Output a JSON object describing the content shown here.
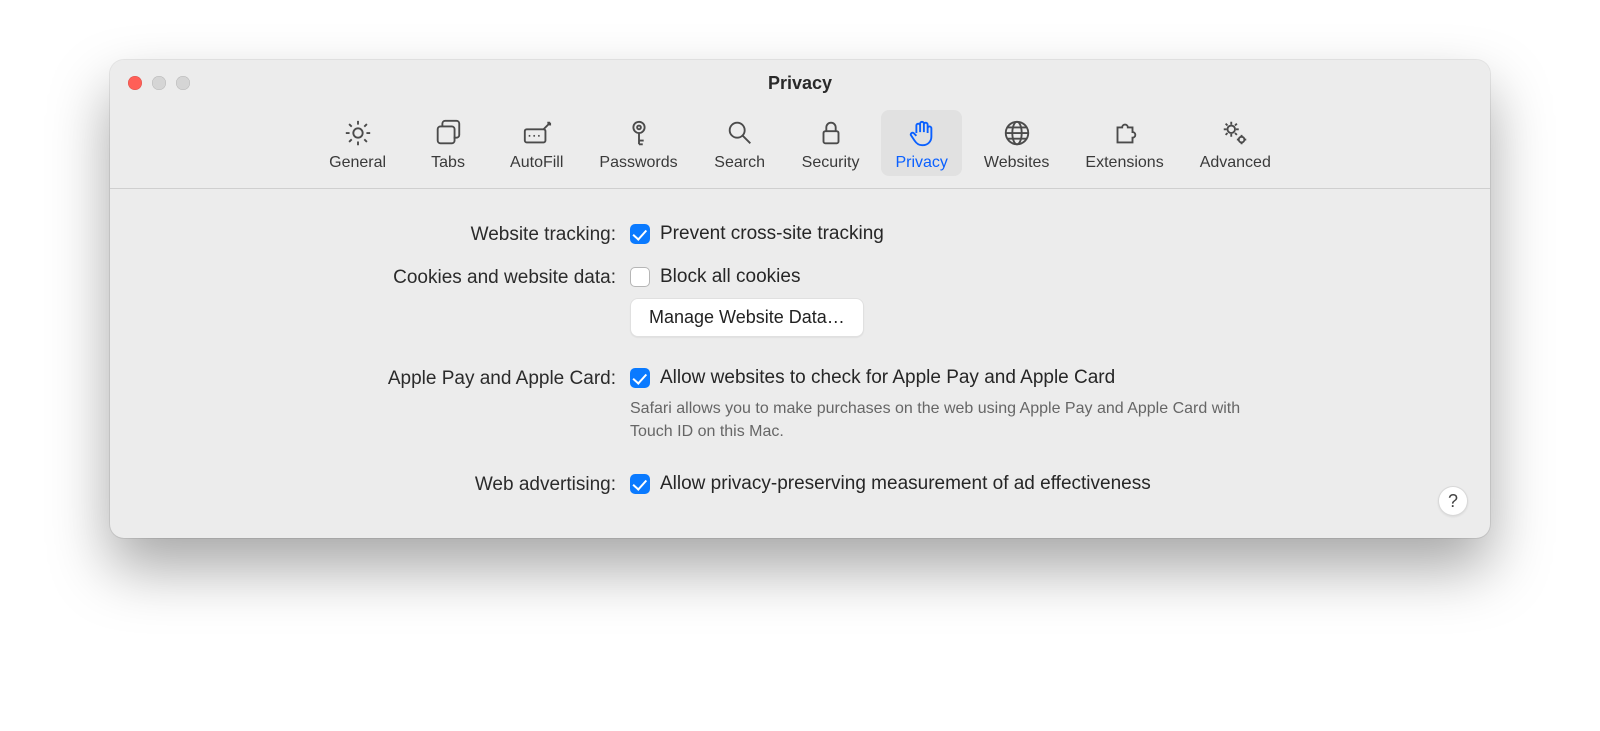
{
  "window": {
    "title": "Privacy"
  },
  "toolbar": {
    "items": [
      {
        "id": "general",
        "label": "General"
      },
      {
        "id": "tabs",
        "label": "Tabs"
      },
      {
        "id": "autofill",
        "label": "AutoFill"
      },
      {
        "id": "passwords",
        "label": "Passwords"
      },
      {
        "id": "search",
        "label": "Search"
      },
      {
        "id": "security",
        "label": "Security"
      },
      {
        "id": "privacy",
        "label": "Privacy"
      },
      {
        "id": "websites",
        "label": "Websites"
      },
      {
        "id": "extensions",
        "label": "Extensions"
      },
      {
        "id": "advanced",
        "label": "Advanced"
      }
    ],
    "active": "privacy"
  },
  "sections": {
    "tracking": {
      "label": "Website tracking:",
      "checkbox_label": "Prevent cross-site tracking",
      "checked": true
    },
    "cookies": {
      "label": "Cookies and website data:",
      "checkbox_label": "Block all cookies",
      "checked": false,
      "button_label": "Manage Website Data…"
    },
    "applepay": {
      "label": "Apple Pay and Apple Card:",
      "checkbox_label": "Allow websites to check for Apple Pay and Apple Card",
      "checked": true,
      "description": "Safari allows you to make purchases on the web using Apple Pay and Apple Card with Touch ID on this Mac."
    },
    "advertising": {
      "label": "Web advertising:",
      "checkbox_label": "Allow privacy-preserving measurement of ad effectiveness",
      "checked": true
    }
  },
  "help_label": "?"
}
